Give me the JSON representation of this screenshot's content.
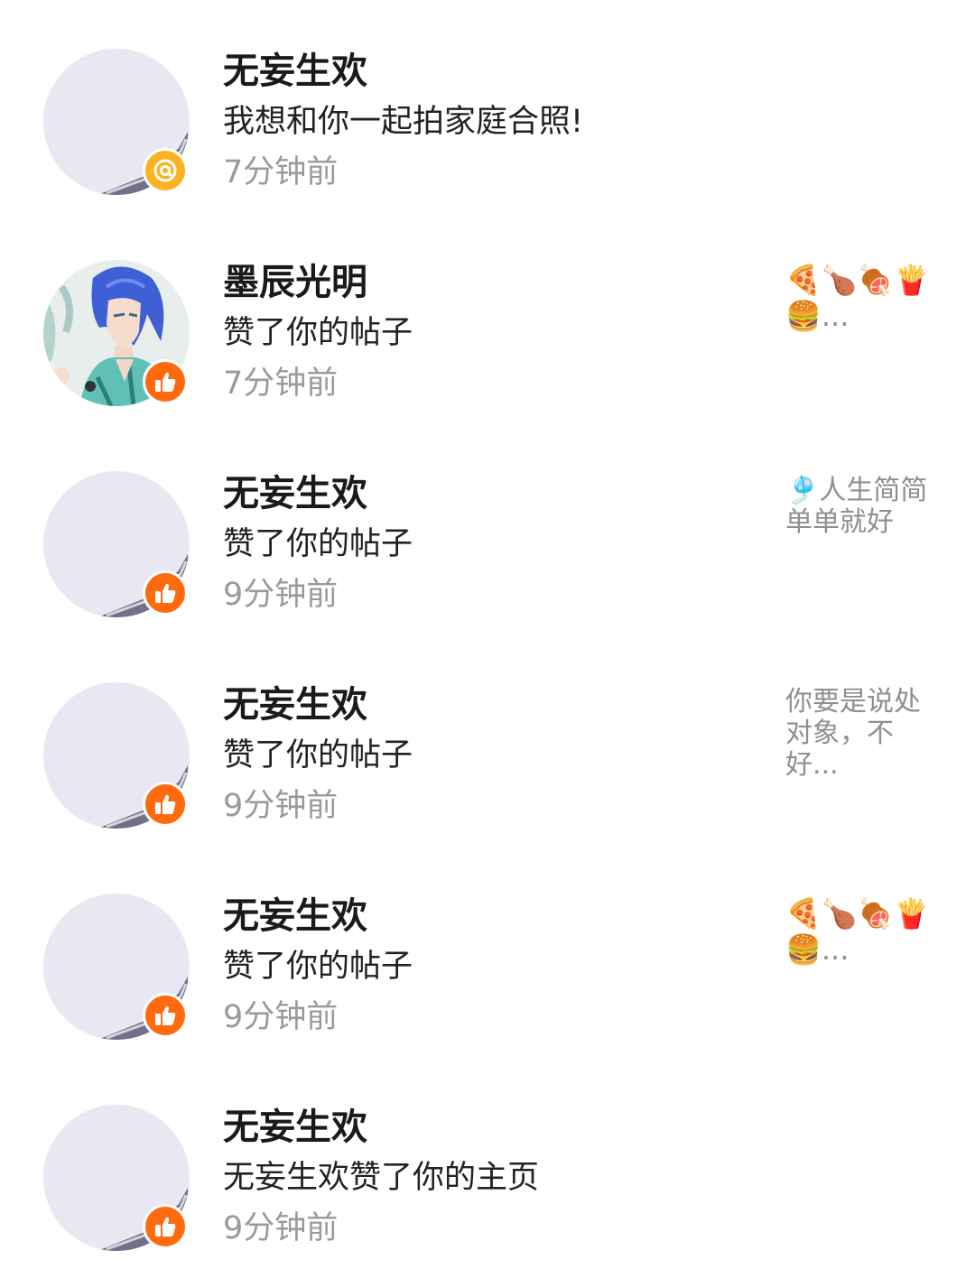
{
  "colors": {
    "mention_badge": "#fbb221",
    "like_badge": "#ff6a0f",
    "avatar_placeholder": "#e9e7f1"
  },
  "notifications": [
    {
      "name": "无妄生欢",
      "action": "我想和你一起拍家庭合照!",
      "time": "7分钟前",
      "badge": "at-icon",
      "avatar": "placeholder",
      "preview": ""
    },
    {
      "name": "墨辰光明",
      "action": "赞了你的帖子",
      "time": "7分钟前",
      "badge": "thumbs-up-icon",
      "avatar": "anime-portrait",
      "preview": "🍕🍗🍖🍟🍔..."
    },
    {
      "name": "无妄生欢",
      "action": "赞了你的帖子",
      "time": "9分钟前",
      "badge": "thumbs-up-icon",
      "avatar": "placeholder",
      "preview": "🎐人生简简单单就好"
    },
    {
      "name": "无妄生欢",
      "action": "赞了你的帖子",
      "time": "9分钟前",
      "badge": "thumbs-up-icon",
      "avatar": "placeholder",
      "preview": "你要是说处对象，不好..."
    },
    {
      "name": "无妄生欢",
      "action": "赞了你的帖子",
      "time": "9分钟前",
      "badge": "thumbs-up-icon",
      "avatar": "placeholder",
      "preview": "🍕🍗🍖🍟🍔..."
    },
    {
      "name": "无妄生欢",
      "action": "无妄生欢赞了你的主页",
      "time": "9分钟前",
      "badge": "thumbs-up-icon",
      "avatar": "placeholder",
      "preview": ""
    }
  ]
}
